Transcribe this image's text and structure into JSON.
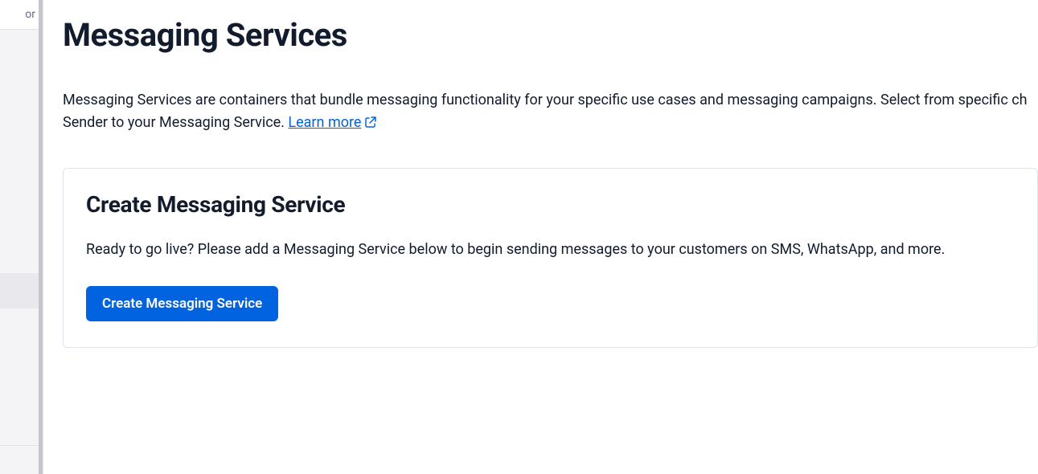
{
  "sidebar": {
    "cutoff_item_text": "or",
    "active_item_label": ""
  },
  "page": {
    "title": "Messaging Services",
    "description_part1": "Messaging Services are containers that bundle messaging functionality for your specific use cases and messaging campaigns. Select from specific ch",
    "description_part2": "Sender to your Messaging Service. ",
    "learn_more_label": "Learn more"
  },
  "card": {
    "title": "Create Messaging Service",
    "text": "Ready to go live? Please add a Messaging Service below to begin sending messages to your customers on SMS, WhatsApp, and more.",
    "button_label": "Create Messaging Service"
  },
  "colors": {
    "primary": "#0263e0",
    "text": "#121c2d",
    "border": "#e1e3ea",
    "sidebar_bg": "#f4f4f6"
  }
}
